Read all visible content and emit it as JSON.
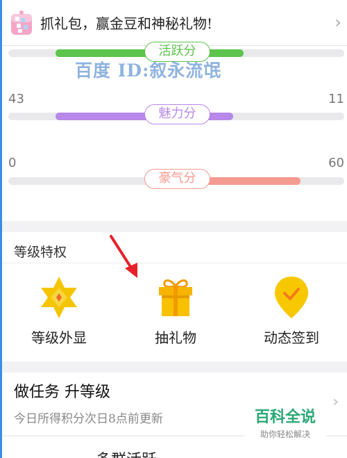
{
  "banner": {
    "text": "抓礼包，赢金豆和神秘礼物!",
    "arrow": "›",
    "icon": "gift-box-icon"
  },
  "watermark": {
    "text": "百度 ID:叙永流氓"
  },
  "scores": [
    {
      "label": "活跃分",
      "color": "#5cc44c",
      "left": null,
      "right": null,
      "fill_from": 0.14,
      "fill_to": 0.7
    },
    {
      "label": "魅力分",
      "color": "#b788e8",
      "left": "43",
      "right": "11",
      "fill_from": 0.14,
      "fill_to": 0.67
    },
    {
      "label": "豪气分",
      "color": "#f59a90",
      "left": "0",
      "right": "60",
      "fill_from": 0.58,
      "fill_to": 0.87
    }
  ],
  "privileges": {
    "title": "等级特权",
    "items": [
      {
        "label": "等级外显",
        "icon": "star-badge-icon"
      },
      {
        "label": "抽礼物",
        "icon": "gift-icon"
      },
      {
        "label": "动态签到",
        "icon": "location-check-icon"
      }
    ]
  },
  "task": {
    "title": "做任务  升等级",
    "subtitle": "今日所得积分次日8点前更新",
    "arrow": "›"
  },
  "bottom": {
    "text": "多群活跃"
  },
  "brand": {
    "name": "百科全说",
    "subtitle": "助你轻松解决"
  },
  "colors": {
    "accent_green": "#5cc44c",
    "accent_purple": "#b788e8",
    "accent_pink": "#f59a90",
    "gold": "#f5b800"
  }
}
